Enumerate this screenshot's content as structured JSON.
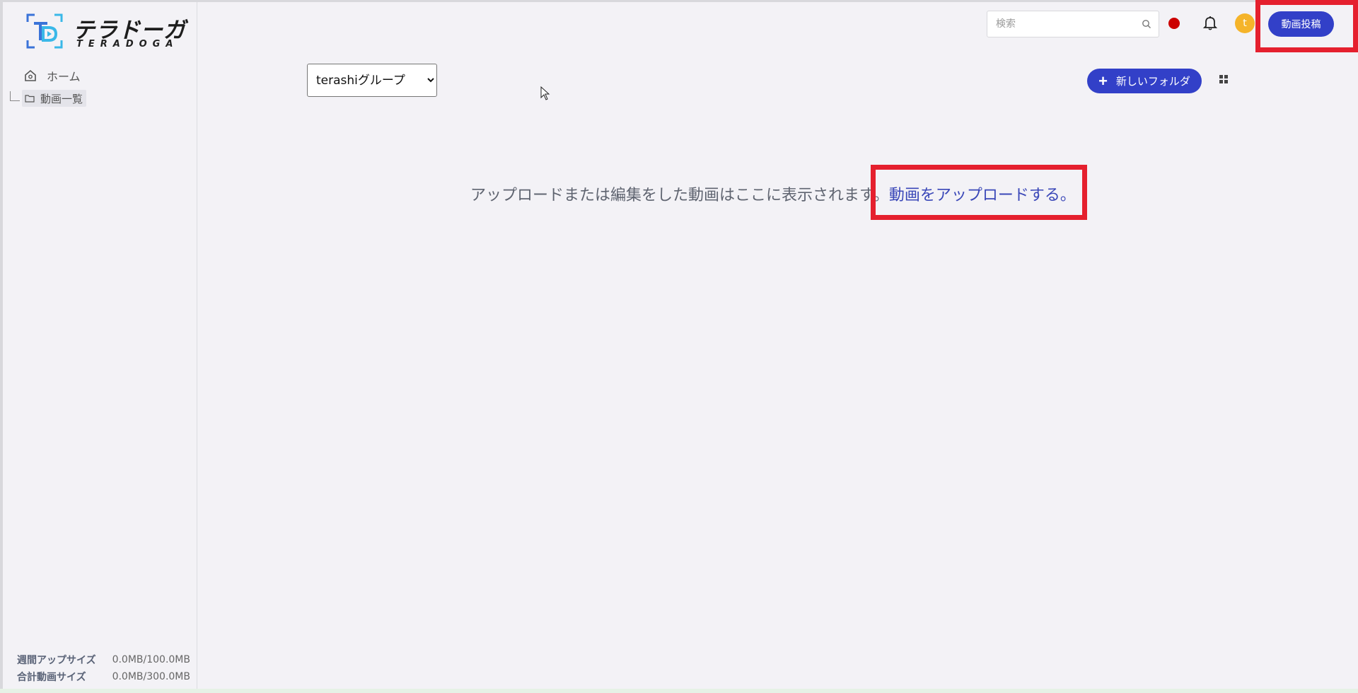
{
  "brand": {
    "name_jp": "テラドーガ",
    "name_en": "TERADOGA",
    "colors": {
      "primary": "#3240c8",
      "logo_blue": "#3a73d8",
      "logo_cyan": "#3ab8e8"
    }
  },
  "sidebar": {
    "home_label": "ホーム",
    "videos_label": "動画一覧",
    "usage": {
      "weekly_label": "週間アップサイズ",
      "weekly_value": "0.0MB/100.0MB",
      "total_label": "合計動画サイズ",
      "total_value": "0.0MB/300.0MB"
    }
  },
  "header": {
    "search_placeholder": "検索",
    "avatar_initial": "t",
    "post_button_label": "動画投稿",
    "record_color": "#cc0000"
  },
  "toolbar": {
    "group_options": [
      "terashiグループ"
    ],
    "group_selected": "terashiグループ",
    "new_folder_label": "新しいフォルダ",
    "new_folder_icon": "plus-icon",
    "view_toggle_icon": "grid-icon"
  },
  "main": {
    "empty_message": "アップロードまたは編集をした動画はここに表示されます。",
    "upload_link": "動画をアップロードする。"
  },
  "annotations": {
    "highlight_color": "#e5202e"
  }
}
